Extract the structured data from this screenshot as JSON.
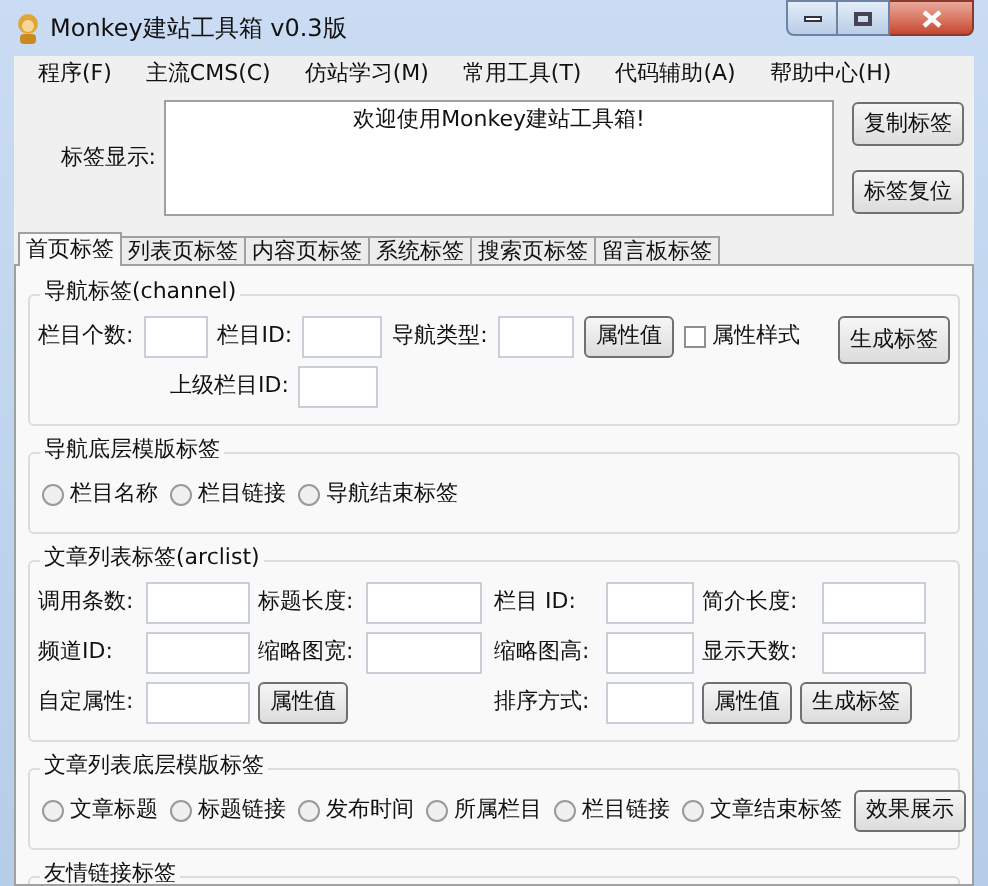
{
  "window": {
    "title": "Monkey建站工具箱 v0.3版"
  },
  "menu": [
    "程序(F)",
    "主流CMS(C)",
    "仿站学习(M)",
    "常用工具(T)",
    "代码辅助(A)",
    "帮助中心(H)"
  ],
  "tag_display": {
    "label": "标签显示:",
    "value": "欢迎使用Monkey建站工具箱!",
    "buttons": [
      "复制标签",
      "标签复位"
    ]
  },
  "tabs": [
    {
      "label": "首页标签",
      "selected": true
    },
    {
      "label": "列表页标签",
      "selected": false
    },
    {
      "label": "内容页标签",
      "selected": false
    },
    {
      "label": "系统标签",
      "selected": false
    },
    {
      "label": "搜索页标签",
      "selected": false
    },
    {
      "label": "留言板标签",
      "selected": false
    }
  ],
  "sections": [
    {
      "kind": "channel",
      "title": "导航标签(channel)",
      "fields": [
        {
          "kind": "label",
          "text": "栏目个数:"
        },
        {
          "kind": "input"
        },
        {
          "kind": "label",
          "text": "栏目ID:"
        },
        {
          "kind": "input"
        },
        {
          "kind": "label",
          "text": "导航类型:"
        },
        {
          "kind": "input"
        },
        {
          "kind": "button",
          "text": "属性值"
        },
        {
          "kind": "checkbox",
          "text": "属性样式",
          "checked": false
        }
      ],
      "parent_id_label": "上级栏目ID:",
      "action": "生成标签"
    },
    {
      "kind": "radios",
      "title": "导航底层模版标签",
      "options": [
        {
          "label": "栏目名称",
          "selected": false
        },
        {
          "label": "栏目链接",
          "selected": false
        },
        {
          "label": "导航结束标签",
          "selected": false
        }
      ]
    },
    {
      "kind": "arclist",
      "title": "文章列表标签(arclist)",
      "rows": [
        {
          "left": [
            {
              "kind": "label",
              "text": "调用条数:"
            },
            {
              "kind": "input"
            },
            {
              "kind": "label",
              "text": "标题长度:"
            },
            {
              "kind": "input"
            }
          ],
          "right": [
            {
              "kind": "label",
              "text": "栏目 ID:"
            },
            {
              "kind": "input"
            },
            {
              "kind": "label",
              "text": "简介长度:"
            },
            {
              "kind": "input"
            }
          ]
        },
        {
          "left": [
            {
              "kind": "label",
              "text": "频道ID:"
            },
            {
              "kind": "input"
            },
            {
              "kind": "label",
              "text": "缩略图宽:"
            },
            {
              "kind": "input"
            }
          ],
          "right": [
            {
              "kind": "label",
              "text": "缩略图高:"
            },
            {
              "kind": "input"
            },
            {
              "kind": "label",
              "text": "显示天数:"
            },
            {
              "kind": "input"
            }
          ]
        },
        {
          "left": [
            {
              "kind": "label",
              "text": "自定属性:"
            },
            {
              "kind": "input"
            },
            {
              "kind": "button",
              "text": "属性值"
            }
          ],
          "right": [
            {
              "kind": "label",
              "text": "排序方式:"
            },
            {
              "kind": "input"
            },
            {
              "kind": "button",
              "text": "属性值"
            },
            {
              "kind": "button",
              "text": "生成标签"
            }
          ]
        }
      ]
    },
    {
      "kind": "radios",
      "title": "文章列表底层模版标签",
      "options": [
        {
          "label": "文章标题",
          "selected": false
        },
        {
          "label": "标题链接",
          "selected": false
        },
        {
          "label": "发布时间",
          "selected": false
        },
        {
          "label": "所属栏目",
          "selected": false
        },
        {
          "label": "栏目链接",
          "selected": false
        },
        {
          "label": "文章结束标签",
          "selected": false
        }
      ],
      "action": "效果展示"
    },
    {
      "kind": "empty",
      "title": "友情链接标签"
    }
  ]
}
